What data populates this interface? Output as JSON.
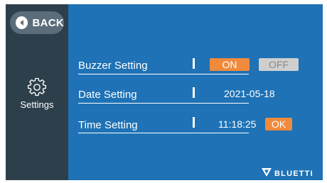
{
  "sidebar": {
    "back_label": "BACK",
    "nav_label": "Settings",
    "nav_icon": "gear-icon"
  },
  "settings": [
    {
      "label": "Buzzer Setting"
    },
    {
      "label": "Date Setting"
    },
    {
      "label": "Time Setting"
    }
  ],
  "buzzer": {
    "on_label": "ON",
    "off_label": "OFF",
    "selected": "ON"
  },
  "date": {
    "value": "2021-05-18"
  },
  "time": {
    "value": "11:18:25",
    "ok_label": "OK"
  },
  "brand": {
    "name": "BLUETTI"
  },
  "colors": {
    "screen_bg": "#1e72b5",
    "sidebar_bg": "#2e3f4c",
    "back_button_bg": "#5b6d7a",
    "accent": "#f08a3c",
    "inactive": "#cfcfcf"
  }
}
